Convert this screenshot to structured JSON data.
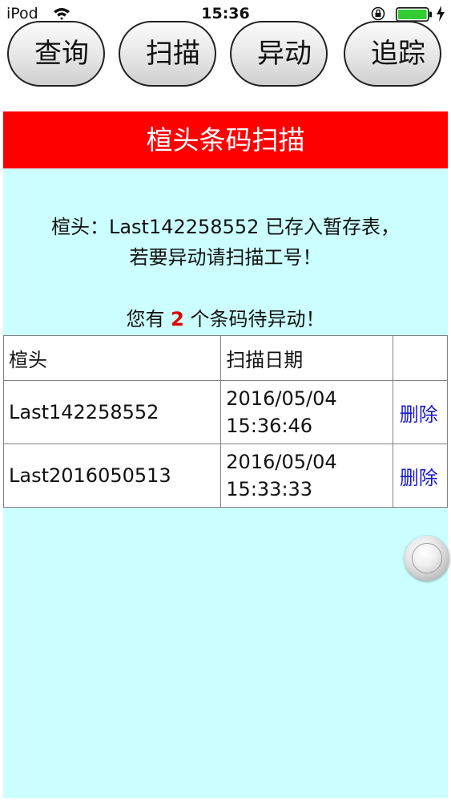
{
  "status_bar": {
    "carrier": "iPod",
    "time": "15:36"
  },
  "nav": {
    "buttons": [
      {
        "label": "查询"
      },
      {
        "label": "扫描"
      },
      {
        "label": "异动"
      },
      {
        "label": "追踪"
      }
    ]
  },
  "page": {
    "title": "楦头条码扫描",
    "message_line1": "楦头：Last142258552 已存入暂存表，",
    "message_line2": "若要异动请扫描工号！",
    "pending_prefix": "您有",
    "pending_count": "2",
    "pending_suffix": "个条码待异动！"
  },
  "table": {
    "headers": {
      "code": "楦头",
      "date": "扫描日期",
      "action": ""
    },
    "rows": [
      {
        "code": "Last142258552",
        "date": "2016/05/04",
        "time": "15:36:46",
        "action": "删除"
      },
      {
        "code": "Last2016050513",
        "date": "2016/05/04",
        "time": "15:33:33",
        "action": "删除"
      }
    ]
  },
  "colors": {
    "banner": "#ff0000",
    "panel": "#ccffff",
    "count": "#e00000",
    "link": "#1a1acc",
    "battery": "#33cc33"
  }
}
